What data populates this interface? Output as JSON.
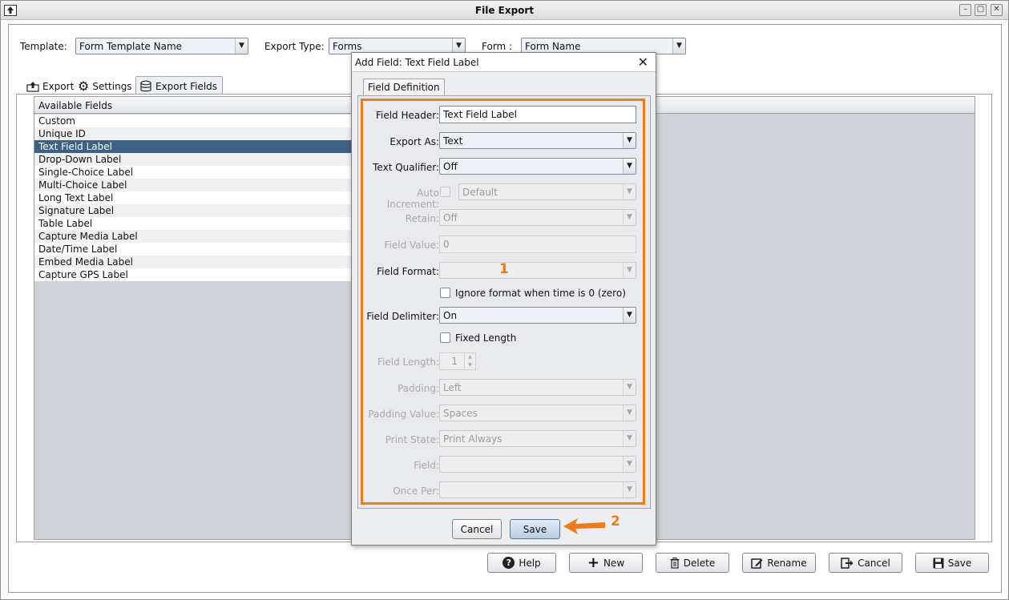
{
  "window": {
    "title": "File Export"
  },
  "toolbar": {
    "template_label": "Template:",
    "template_value": "Form Template Name",
    "export_type_label": "Export Type:",
    "export_type_value": "Forms",
    "form_label": "Form :",
    "form_value": "Form Name"
  },
  "tabs": [
    {
      "label": "Export",
      "icon": "export-icon"
    },
    {
      "label": "Settings",
      "icon": "gear-icon"
    },
    {
      "label": "Export Fields",
      "icon": "database-icon",
      "active": true
    }
  ],
  "available_fields": {
    "header": "Available Fields",
    "items": [
      "Custom",
      "Unique ID",
      "Text Field Label",
      "Drop-Down Label",
      "Single-Choice Label",
      "Multi-Choice Label",
      "Long Text Label",
      "Signature Label",
      "Table Label",
      "Capture Media Label",
      "Date/Time Label",
      "Embed Media Label",
      "Capture GPS Label"
    ],
    "selected": "Text Field Label"
  },
  "bottom_buttons": {
    "help": "Help",
    "new": "New",
    "delete": "Delete",
    "rename": "Rename",
    "cancel": "Cancel",
    "save": "Save"
  },
  "dialog": {
    "title": "Add Field: Text Field Label",
    "tab": "Field Definition",
    "field_header_label": "Field Header:",
    "field_header_value": "Text Field Label",
    "export_as_label": "Export As:",
    "export_as_value": "Text",
    "text_qualifier_label": "Text Qualifier:",
    "text_qualifier_value": "Off",
    "auto_increment_label": "Auto Increment:",
    "auto_increment_value": "Default",
    "retain_label": "Retain:",
    "retain_value": "Off",
    "field_value_label": "Field Value:",
    "field_value_value": "0",
    "field_format_label": "Field Format:",
    "ignore_format_label": "Ignore format when time is 0 (zero)",
    "field_delimiter_label": "Field Delimiter:",
    "field_delimiter_value": "On",
    "fixed_length_label": "Fixed Length",
    "field_length_label": "Field Length:",
    "field_length_value": "1",
    "padding_label": "Padding:",
    "padding_value": "Left",
    "padding_value_label": "Padding Value:",
    "padding_value_value": "Spaces",
    "print_state_label": "Print State:",
    "print_state_value": "Print Always",
    "field_label": "Field:",
    "once_per_label": "Once Per:",
    "cancel": "Cancel",
    "save": "Save"
  },
  "callouts": {
    "one": "1",
    "two": "2"
  },
  "colors": {
    "highlight": "#f07b16",
    "selection": "#3d6185"
  }
}
